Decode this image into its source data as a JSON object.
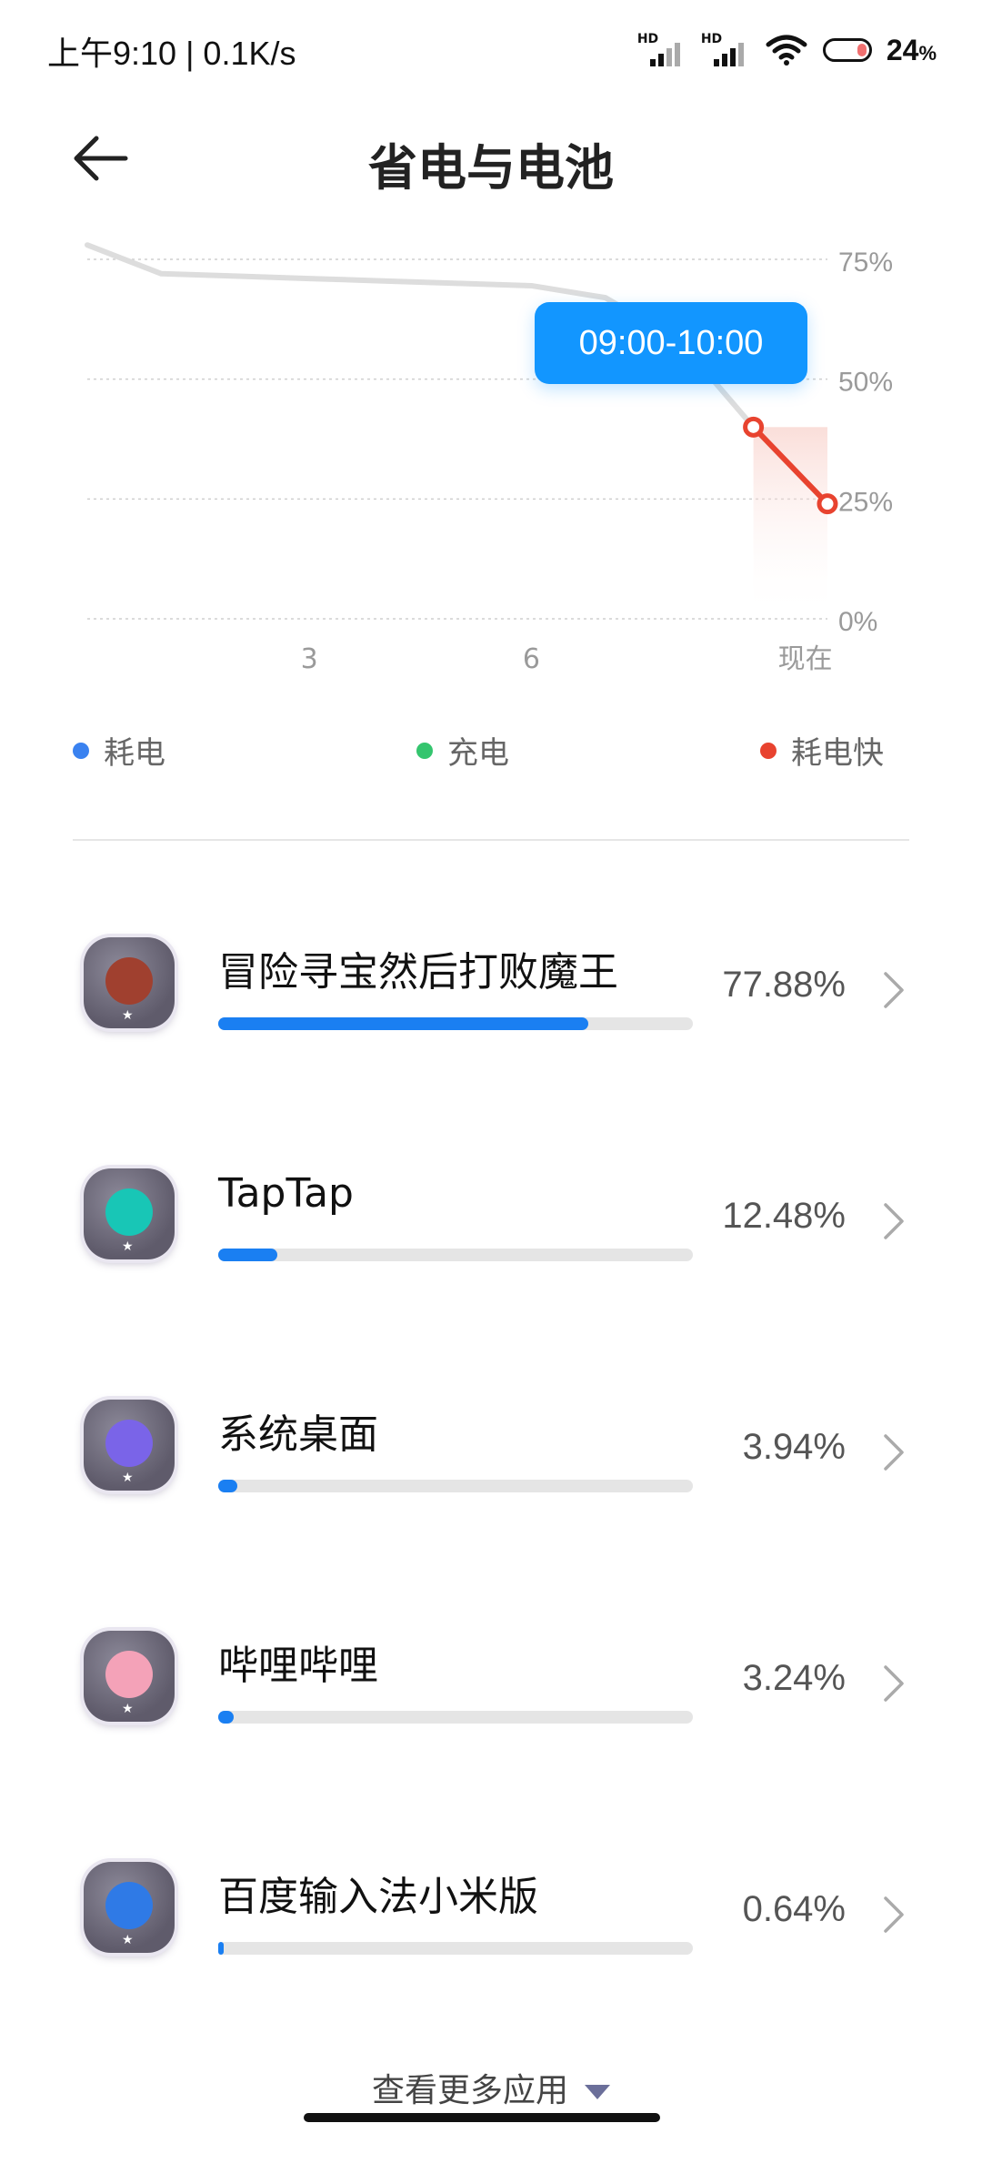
{
  "status_bar": {
    "time_speed": "上午9:10 | 0.1K/s",
    "sim1_hd": "HD",
    "sim2_hd": "HD",
    "battery_value": "24",
    "battery_unit": "%",
    "icons": [
      "signal-icon",
      "signal-icon",
      "wifi-icon",
      "battery-icon"
    ]
  },
  "header": {
    "title": "省电与电池"
  },
  "chart_data": {
    "type": "line",
    "x_ticks": [
      "3",
      "6",
      "现在"
    ],
    "y_ticks": [
      "75%",
      "50%",
      "25%",
      "0%"
    ],
    "ylim": [
      0,
      75
    ],
    "series": [
      {
        "x": [
          0,
          1,
          2,
          3,
          4,
          5,
          6,
          7,
          8,
          9,
          10
        ],
        "values": [
          78,
          72,
          71.5,
          71,
          70.5,
          70,
          69.5,
          67,
          58,
          40,
          24
        ],
        "color": "#dddddd"
      }
    ],
    "highlight": {
      "x": [
        9,
        10
      ],
      "values": [
        40,
        24
      ],
      "color": "#e8432f"
    },
    "tooltip": "09:00-10:00",
    "grid": true
  },
  "legend": [
    {
      "label": "耗电",
      "color": "#3a82f0"
    },
    {
      "label": "充电",
      "color": "#34c56e"
    },
    {
      "label": "耗电快",
      "color": "#e8432f"
    }
  ],
  "apps": [
    {
      "name": "冒险寻宝然后打败魔王",
      "percent_label": "77.88%",
      "usage": 0.7788,
      "icon": "game-icon",
      "icon_color": "#a0402f"
    },
    {
      "name": "TapTap",
      "percent_label": "12.48%",
      "usage": 0.1248,
      "icon": "taptap-icon",
      "icon_color": "#18c6b6"
    },
    {
      "name": "系统桌面",
      "percent_label": "3.94%",
      "usage": 0.0394,
      "icon": "home-icon",
      "icon_color": "#7a64e8"
    },
    {
      "name": "哔哩哔哩",
      "percent_label": "3.24%",
      "usage": 0.0324,
      "icon": "bilibili-icon",
      "icon_color": "#f4a2b8"
    },
    {
      "name": "百度输入法小米版",
      "percent_label": "0.64%",
      "usage": 0.0064,
      "icon": "baidu-input-icon",
      "icon_color": "#2f7ae6"
    }
  ],
  "more_button": {
    "label": "查看更多应用"
  }
}
